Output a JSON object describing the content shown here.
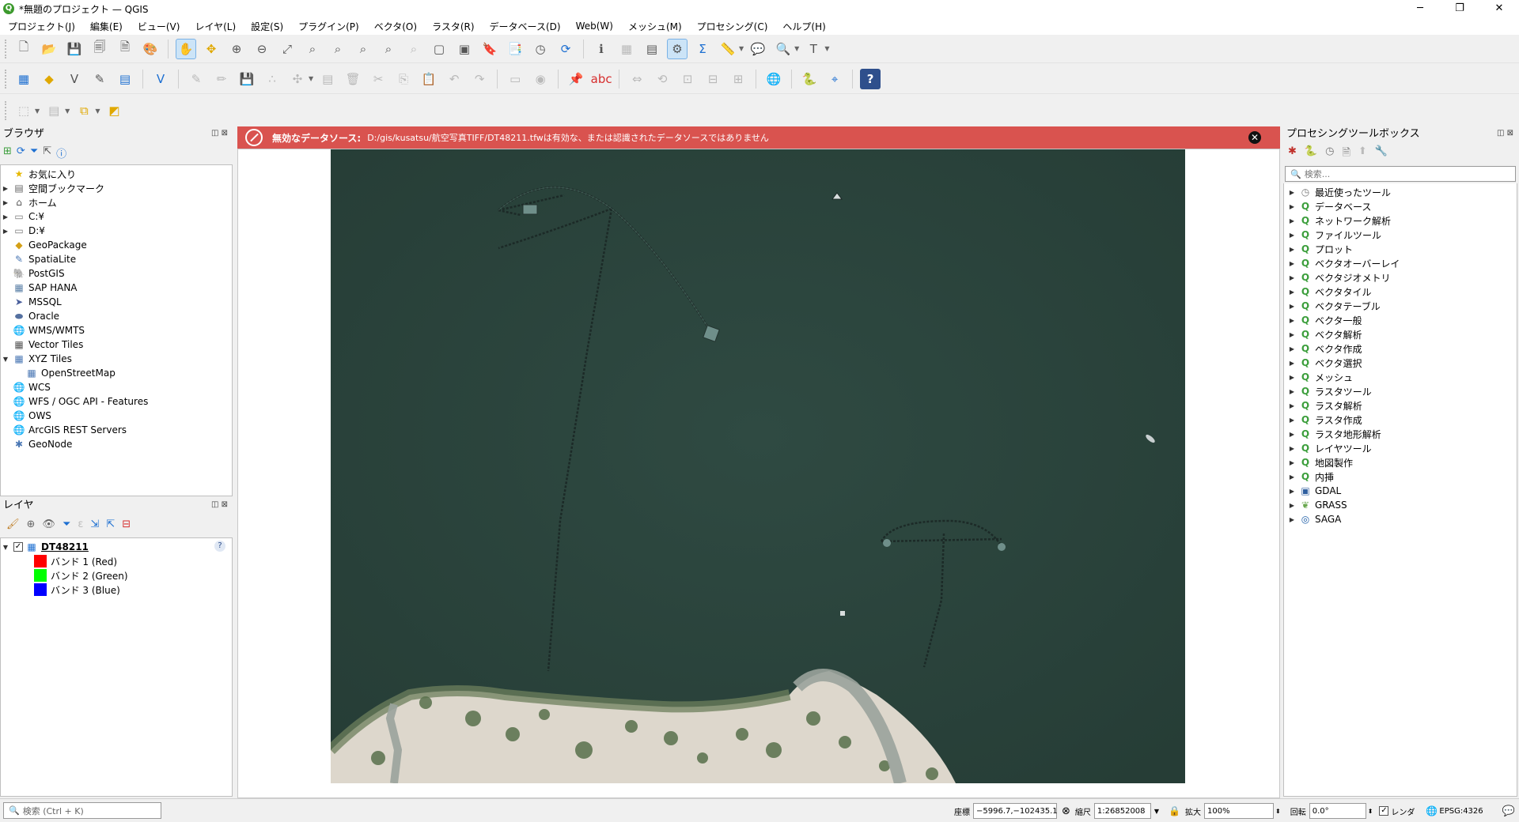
{
  "window": {
    "title": "*無題のプロジェクト — QGIS",
    "app_icon": "Q",
    "min_glyph": "─",
    "restore_glyph": "❐",
    "close_glyph": "✕"
  },
  "menu": [
    "プロジェクト(J)",
    "編集(E)",
    "ビュー(V)",
    "レイヤ(L)",
    "設定(S)",
    "プラグイン(P)",
    "ベクタ(O)",
    "ラスタ(R)",
    "データベース(D)",
    "Web(W)",
    "メッシュ(M)",
    "プロセシング(C)",
    "ヘルプ(H)"
  ],
  "browser": {
    "title": "ブラウザ",
    "items": [
      {
        "label": "お気に入り",
        "icon": "star-icon",
        "glyph": "★",
        "color": "#e6b800",
        "arrow": "",
        "indent": 0
      },
      {
        "label": "空間ブックマーク",
        "icon": "bookmark-icon",
        "glyph": "▤",
        "color": "#666666",
        "arrow": "▶",
        "indent": 0
      },
      {
        "label": "ホーム",
        "icon": "home-folder-icon",
        "glyph": "⌂",
        "color": "#555555",
        "arrow": "▶",
        "indent": 0
      },
      {
        "label": "C:¥",
        "icon": "drive-icon",
        "glyph": "▭",
        "color": "#777777",
        "arrow": "▶",
        "indent": 0
      },
      {
        "label": "D:¥",
        "icon": "drive-icon",
        "glyph": "▭",
        "color": "#777777",
        "arrow": "▶",
        "indent": 0
      },
      {
        "label": "GeoPackage",
        "icon": "geopackage-icon",
        "glyph": "◆",
        "color": "#d4a017",
        "arrow": "",
        "indent": 0
      },
      {
        "label": "SpatiaLite",
        "icon": "spatialite-icon",
        "glyph": "✎",
        "color": "#4a77b4",
        "arrow": "",
        "indent": 0
      },
      {
        "label": "PostGIS",
        "icon": "postgis-icon",
        "glyph": "🐘",
        "color": "#336791",
        "arrow": "",
        "indent": 0
      },
      {
        "label": "SAP HANA",
        "icon": "database-icon",
        "glyph": "▦",
        "color": "#5a7fa6",
        "arrow": "",
        "indent": 0
      },
      {
        "label": "MSSQL",
        "icon": "mssql-icon",
        "glyph": "➤",
        "color": "#4a5f9c",
        "arrow": "",
        "indent": 0
      },
      {
        "label": "Oracle",
        "icon": "oracle-icon",
        "glyph": "⬬",
        "color": "#5470a0",
        "arrow": "",
        "indent": 0
      },
      {
        "label": "WMS/WMTS",
        "icon": "globe-icon",
        "glyph": "🌐",
        "color": "#4a77b4",
        "arrow": "",
        "indent": 0
      },
      {
        "label": "Vector Tiles",
        "icon": "vector-tiles-icon",
        "glyph": "▦",
        "color": "#555555",
        "arrow": "",
        "indent": 0
      },
      {
        "label": "XYZ Tiles",
        "icon": "xyz-tiles-icon",
        "glyph": "▦",
        "color": "#4a77b4",
        "arrow": "▼",
        "indent": 0
      },
      {
        "label": "OpenStreetMap",
        "icon": "tiles-icon",
        "glyph": "▦",
        "color": "#4a77b4",
        "arrow": "",
        "indent": 1
      },
      {
        "label": "WCS",
        "icon": "globe-icon",
        "glyph": "🌐",
        "color": "#4a77b4",
        "arrow": "",
        "indent": 0
      },
      {
        "label": "WFS / OGC API - Features",
        "icon": "globe-icon",
        "glyph": "🌐",
        "color": "#4a77b4",
        "arrow": "",
        "indent": 0
      },
      {
        "label": "OWS",
        "icon": "globe-icon",
        "glyph": "🌐",
        "color": "#8aa6c8",
        "arrow": "",
        "indent": 0
      },
      {
        "label": "ArcGIS REST Servers",
        "icon": "arcgis-icon",
        "glyph": "🌐",
        "color": "#4a77b4",
        "arrow": "",
        "indent": 0
      },
      {
        "label": "GeoNode",
        "icon": "geonode-icon",
        "glyph": "✱",
        "color": "#4a77b4",
        "arrow": "",
        "indent": 0
      }
    ]
  },
  "layers": {
    "title": "レイヤ",
    "layer_name": "DT48211",
    "help_glyph": "?",
    "bands": [
      {
        "label": "バンド 1 (Red)",
        "color": "#ff0000"
      },
      {
        "label": "バンド 2 (Green)",
        "color": "#00ff00"
      },
      {
        "label": "バンド 3 (Blue)",
        "color": "#0000ff"
      }
    ]
  },
  "message": {
    "title": "無効なデータソース:",
    "text": "D:/gis/kusatsu/航空写真TIFF/DT48211.tfwは有効な、または認識されたデータソースではありません",
    "close_glyph": "✕"
  },
  "processing": {
    "title": "プロセシングツールボックス",
    "search_placeholder": "検索...",
    "items": [
      {
        "label": "最近使ったツール",
        "icon": "clock-icon",
        "glyph": "◷",
        "color": "#777777"
      },
      {
        "label": "データベース",
        "icon": "qgis-icon",
        "glyph": "Q",
        "color": "#3b9e3b"
      },
      {
        "label": "ネットワーク解析",
        "icon": "qgis-icon",
        "glyph": "Q",
        "color": "#3b9e3b"
      },
      {
        "label": "ファイルツール",
        "icon": "qgis-icon",
        "glyph": "Q",
        "color": "#3b9e3b"
      },
      {
        "label": "プロット",
        "icon": "qgis-icon",
        "glyph": "Q",
        "color": "#3b9e3b"
      },
      {
        "label": "ベクタオーバーレイ",
        "icon": "qgis-icon",
        "glyph": "Q",
        "color": "#3b9e3b"
      },
      {
        "label": "ベクタジオメトリ",
        "icon": "qgis-icon",
        "glyph": "Q",
        "color": "#3b9e3b"
      },
      {
        "label": "ベクタタイル",
        "icon": "qgis-icon",
        "glyph": "Q",
        "color": "#3b9e3b"
      },
      {
        "label": "ベクタテーブル",
        "icon": "qgis-icon",
        "glyph": "Q",
        "color": "#3b9e3b"
      },
      {
        "label": "ベクタ一般",
        "icon": "qgis-icon",
        "glyph": "Q",
        "color": "#3b9e3b"
      },
      {
        "label": "ベクタ解析",
        "icon": "qgis-icon",
        "glyph": "Q",
        "color": "#3b9e3b"
      },
      {
        "label": "ベクタ作成",
        "icon": "qgis-icon",
        "glyph": "Q",
        "color": "#3b9e3b"
      },
      {
        "label": "ベクタ選択",
        "icon": "qgis-icon",
        "glyph": "Q",
        "color": "#3b9e3b"
      },
      {
        "label": "メッシュ",
        "icon": "qgis-icon",
        "glyph": "Q",
        "color": "#3b9e3b"
      },
      {
        "label": "ラスタツール",
        "icon": "qgis-icon",
        "glyph": "Q",
        "color": "#3b9e3b"
      },
      {
        "label": "ラスタ解析",
        "icon": "qgis-icon",
        "glyph": "Q",
        "color": "#3b9e3b"
      },
      {
        "label": "ラスタ作成",
        "icon": "qgis-icon",
        "glyph": "Q",
        "color": "#3b9e3b"
      },
      {
        "label": "ラスタ地形解析",
        "icon": "qgis-icon",
        "glyph": "Q",
        "color": "#3b9e3b"
      },
      {
        "label": "レイヤツール",
        "icon": "qgis-icon",
        "glyph": "Q",
        "color": "#3b9e3b"
      },
      {
        "label": "地図製作",
        "icon": "qgis-icon",
        "glyph": "Q",
        "color": "#3b9e3b"
      },
      {
        "label": "内挿",
        "icon": "qgis-icon",
        "glyph": "Q",
        "color": "#3b9e3b"
      },
      {
        "label": "GDAL",
        "icon": "gdal-icon",
        "glyph": "▣",
        "color": "#2f5f9f"
      },
      {
        "label": "GRASS",
        "icon": "grass-icon",
        "glyph": "❦",
        "color": "#6aa84f"
      },
      {
        "label": "SAGA",
        "icon": "saga-icon",
        "glyph": "◎",
        "color": "#1f5fa8"
      }
    ]
  },
  "status": {
    "search_placeholder": "検索 (Ctrl + K)",
    "coord_label": "座標",
    "coord_value": "−5996.7,−102435.1",
    "scale_label": "縮尺",
    "scale_value": "1:26852008",
    "magnifier_label": "拡大",
    "magnifier_value": "100%",
    "rotation_label": "回転",
    "rotation_value": "0.0°",
    "render_label": "レンダ",
    "crs": "EPSG:4326"
  },
  "colors": {
    "water": "#2f4a42",
    "shore": "#d8d2c8",
    "error_bar": "#d9534f"
  }
}
